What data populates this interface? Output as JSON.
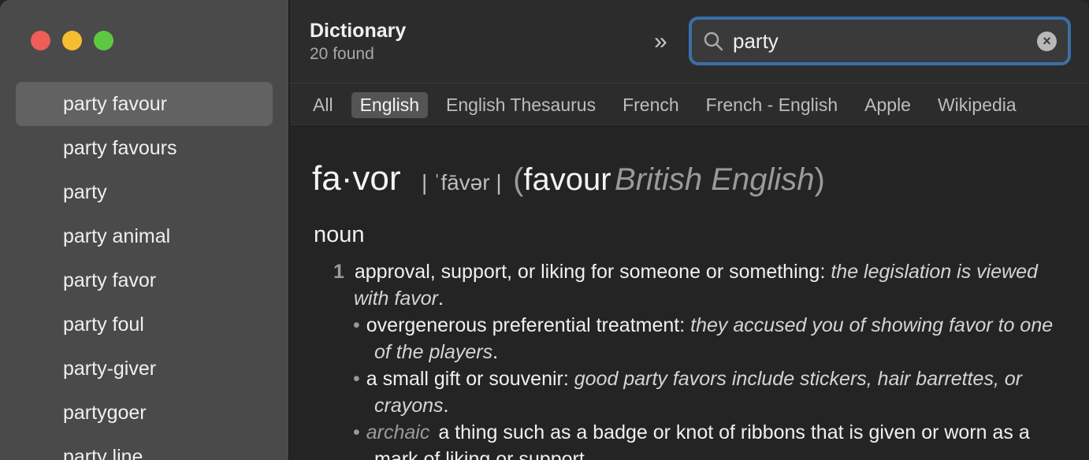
{
  "sidebar": {
    "results": [
      {
        "label": "party favour",
        "selected": true
      },
      {
        "label": "party favours"
      },
      {
        "label": "party"
      },
      {
        "label": "party animal"
      },
      {
        "label": "party favor"
      },
      {
        "label": "party foul"
      },
      {
        "label": "party-giver"
      },
      {
        "label": "partygoer"
      },
      {
        "label": "party line"
      }
    ]
  },
  "toolbar": {
    "title": "Dictionary",
    "subtitle": "20 found",
    "chevron": "»",
    "search": {
      "value": "party",
      "placeholder": "Search"
    },
    "clear_glyph": "×"
  },
  "tabs": [
    {
      "label": "All"
    },
    {
      "label": "English",
      "active": true
    },
    {
      "label": "English Thesaurus"
    },
    {
      "label": "French"
    },
    {
      "label": "French - English"
    },
    {
      "label": "Apple"
    },
    {
      "label": "Wikipedia"
    }
  ],
  "entry": {
    "headword": "fa·vor",
    "pronunciation": "| ˈfāvər |",
    "paren_open": "(",
    "variant": "favour",
    "variant_label": "British English",
    "paren_close": ")",
    "part_of_speech": "noun",
    "definition_1": {
      "number": "1",
      "text": "approval, support, or liking for someone or something:",
      "example": "the legislation is viewed with favor",
      "end": "."
    },
    "subs": [
      {
        "bullet": "•",
        "register": "",
        "text": "overgenerous preferential treatment:",
        "example": "they accused you of showing favor to one of the players",
        "end": "."
      },
      {
        "bullet": "•",
        "register": "",
        "text": "a small gift or souvenir:",
        "example": "good party favors include stickers, hair barrettes, or crayons",
        "end": "."
      },
      {
        "bullet": "•",
        "register": "archaic",
        "text": "a thing such as a badge or knot of ribbons that is given or worn as a mark of liking or support",
        "example": "",
        "end": "."
      }
    ]
  },
  "colors": {
    "accent": "#3a6fa8",
    "sidebar_bg": "#4a4a4a",
    "selected_bg": "#626262",
    "traffic_red": "#ee5d56",
    "traffic_yellow": "#f5bd30",
    "traffic_green": "#5dc842"
  }
}
